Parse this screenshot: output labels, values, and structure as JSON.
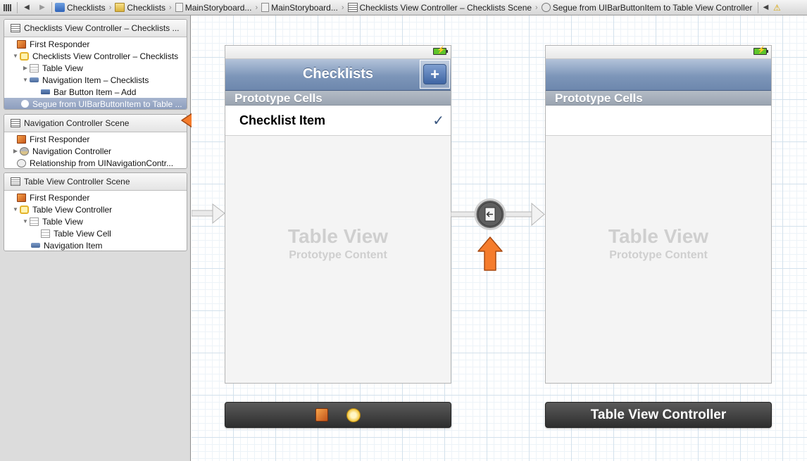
{
  "jumpbar": {
    "crumbs": [
      {
        "label": "Checklists",
        "icon": "project-icon"
      },
      {
        "label": "Checklists",
        "icon": "folder-icon"
      },
      {
        "label": "MainStoryboard...",
        "icon": "file-icon"
      },
      {
        "label": "MainStoryboard...",
        "icon": "file-icon"
      },
      {
        "label": "Checklists View Controller – Checklists Scene",
        "icon": "scene-icon"
      },
      {
        "label": "Segue from UIBarButtonItem to Table View Controller",
        "icon": "segue-icon"
      }
    ],
    "back_arrow": "◀",
    "forward_arrow": "▶"
  },
  "outline": {
    "scene1": {
      "header": "Checklists View Controller – Checklists ...",
      "rows": [
        "First Responder",
        "Checklists View Controller – Checklists",
        "Table View",
        "Navigation Item – Checklists",
        "Bar Button Item – Add",
        "Segue from UIBarButtonItem to Table ..."
      ]
    },
    "scene2": {
      "header": "Navigation Controller Scene",
      "rows": [
        "First Responder",
        "Navigation Controller",
        "Relationship from UINavigationContr..."
      ]
    },
    "scene3": {
      "header": "Table View Controller Scene",
      "rows": [
        "First Responder",
        "Table View Controller",
        "Table View",
        "Table View Cell",
        "Navigation Item"
      ]
    }
  },
  "canvas": {
    "left_device": {
      "nav_title": "Checklists",
      "add_button": "+",
      "section_header": "Prototype Cells",
      "cell_label": "Checklist Item",
      "checkmark": "✓",
      "placeholder_title": "Table View",
      "placeholder_subtitle": "Prototype Content"
    },
    "right_device": {
      "nav_title": "",
      "section_header": "Prototype Cells",
      "placeholder_title": "Table View",
      "placeholder_subtitle": "Prototype Content",
      "dock_label": "Table View Controller"
    }
  },
  "colors": {
    "highlight_arrow": "#f57c2c",
    "selection": "#8c9dbd",
    "navbar": "#7d96b9"
  }
}
